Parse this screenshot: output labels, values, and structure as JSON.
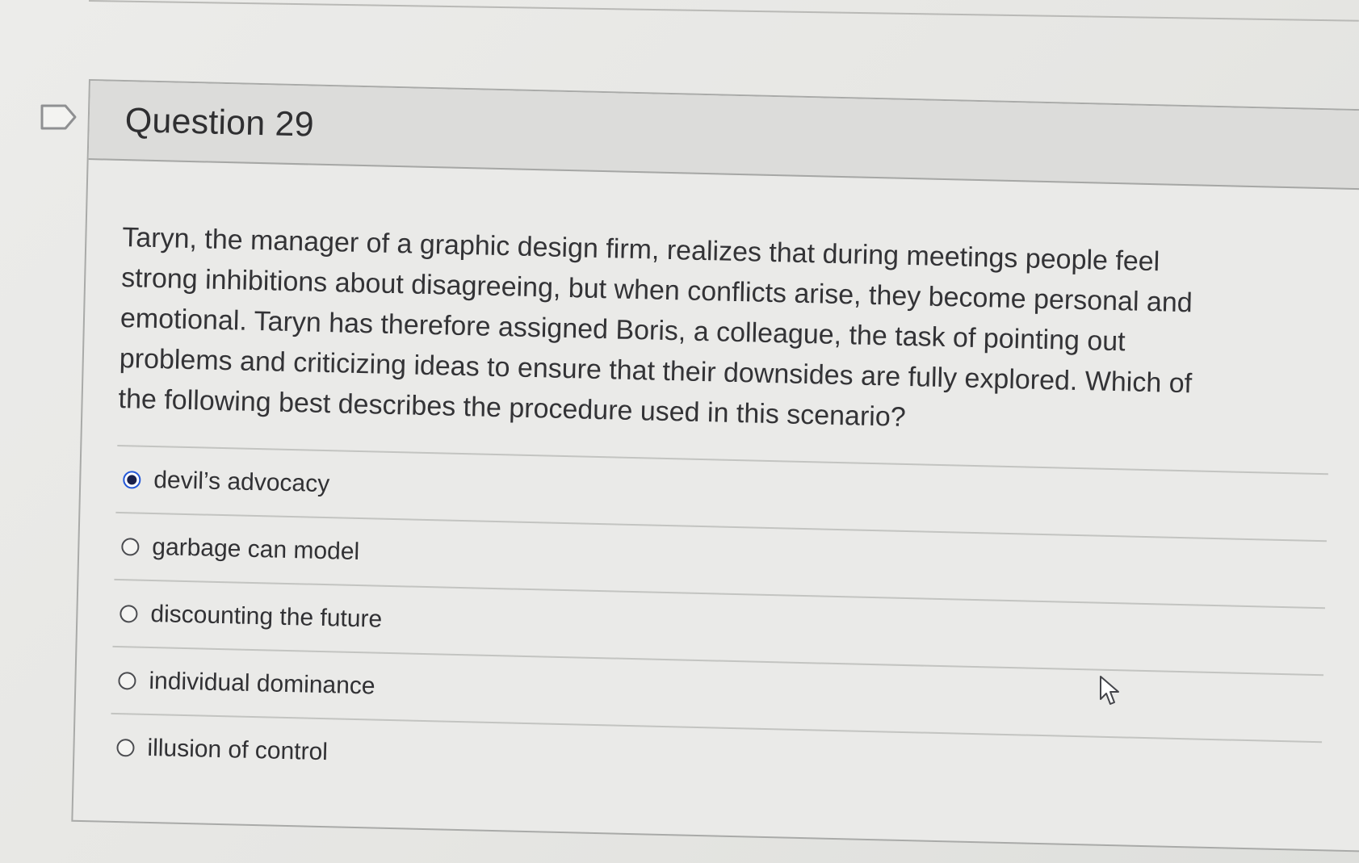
{
  "question": {
    "title": "Question 29",
    "text": "Taryn, the manager of a graphic design firm, realizes that during meetings people feel strong inhibitions about disagreeing, but when conflicts arise, they become personal and emotional. Taryn has therefore assigned Boris, a colleague, the task of pointing out problems and criticizing ideas to ensure that their downsides are fully explored. Which of the following best describes the procedure used in this scenario?",
    "answers": [
      {
        "label": "devil’s advocacy",
        "selected": true
      },
      {
        "label": "garbage can model",
        "selected": false
      },
      {
        "label": "discounting the future",
        "selected": false
      },
      {
        "label": "individual dominance",
        "selected": false
      },
      {
        "label": "illusion of control",
        "selected": false
      }
    ]
  },
  "icons": {
    "flag": "flag-icon",
    "cursor": "mouse-pointer-icon"
  },
  "colors": {
    "selected_radio": "#2458d8",
    "selected_dot": "#1b214a",
    "header_bg": "#dcdcda"
  }
}
